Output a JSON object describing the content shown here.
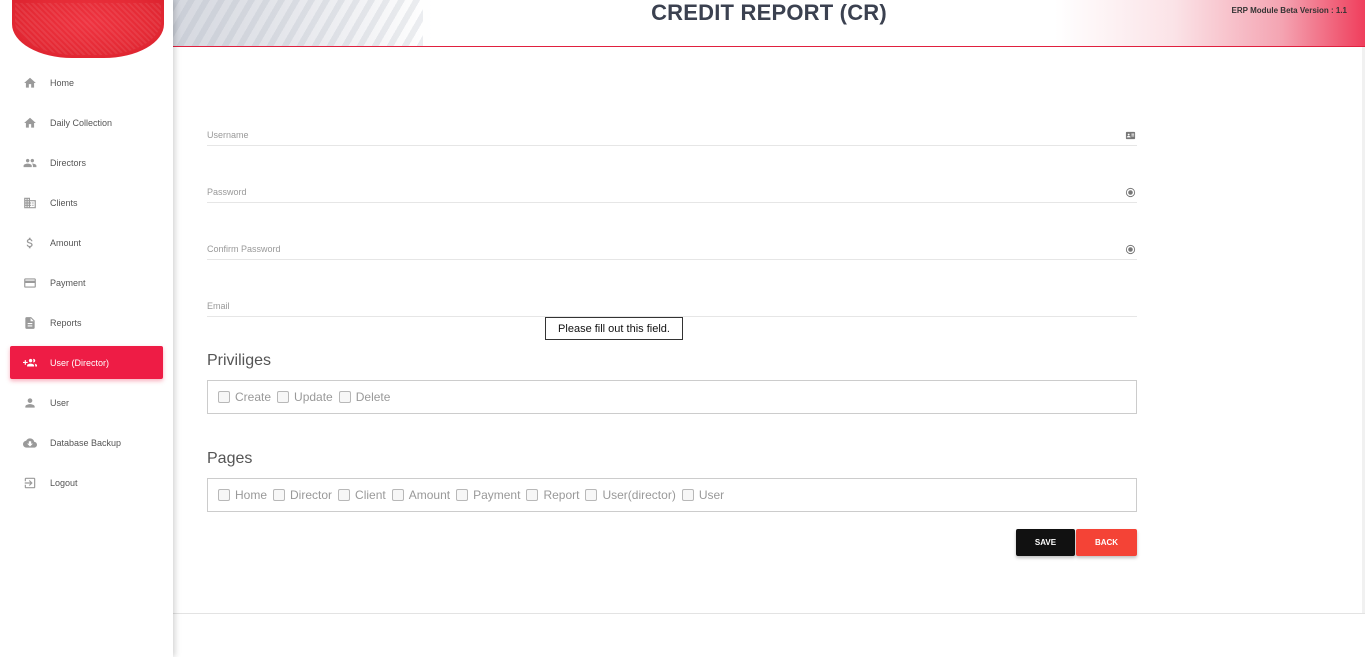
{
  "header": {
    "title": "CREDIT REPORT (CR)",
    "version": "ERP Module Beta Version : 1.1"
  },
  "sidebar": {
    "items": [
      {
        "label": "Home",
        "icon": "home-icon"
      },
      {
        "label": "Daily Collection",
        "icon": "home-icon"
      },
      {
        "label": "Directors",
        "icon": "people-icon"
      },
      {
        "label": "Clients",
        "icon": "building-icon"
      },
      {
        "label": "Amount",
        "icon": "dollar-icon"
      },
      {
        "label": "Payment",
        "icon": "credit-card-icon"
      },
      {
        "label": "Reports",
        "icon": "document-icon"
      },
      {
        "label": "User (Director)",
        "icon": "add-group-icon",
        "active": true
      },
      {
        "label": "User",
        "icon": "person-icon"
      },
      {
        "label": "Database Backup",
        "icon": "cloud-download-icon"
      },
      {
        "label": "Logout",
        "icon": "logout-icon"
      }
    ],
    "active_color": "#ee1c45"
  },
  "form": {
    "username_label": "Username",
    "password_label": "Password",
    "confirm_password_label": "Confirm Password",
    "email_label": "Email",
    "validation_tooltip": "Please fill out this field.",
    "privileges_title": "Priviliges",
    "privileges": [
      "Create",
      "Update",
      "Delete"
    ],
    "pages_title": "Pages",
    "pages": [
      "Home",
      "Director",
      "Client",
      "Amount",
      "Payment",
      "Report",
      "User(director)",
      "User"
    ],
    "save_label": "SAVE",
    "back_label": "BACK"
  }
}
